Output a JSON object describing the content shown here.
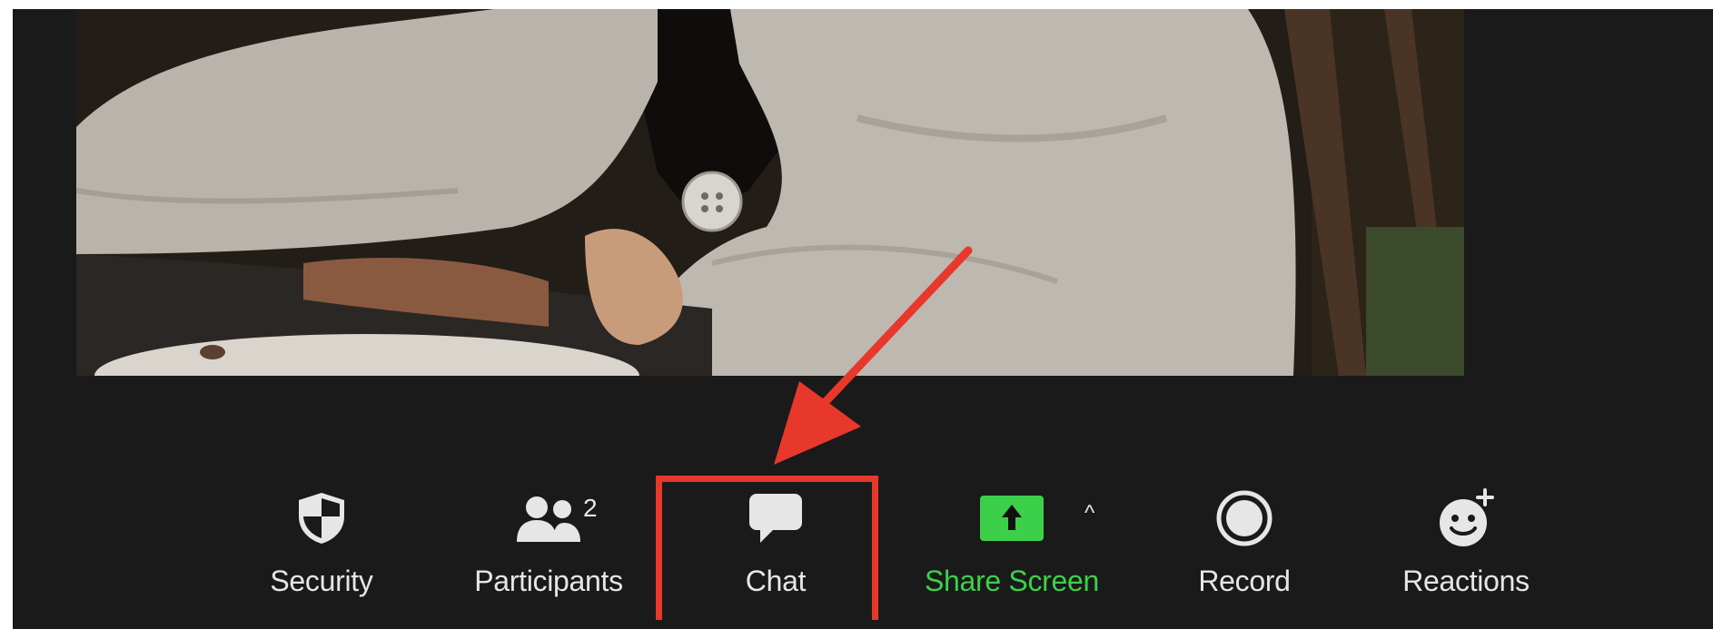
{
  "toolbar": {
    "security_label": "Security",
    "participants_label": "Participants",
    "participants_count": "2",
    "chat_label": "Chat",
    "share_label": "Share Screen",
    "share_options_caret": "^",
    "record_label": "Record",
    "reactions_label": "Reactions"
  },
  "icons": {
    "security": "shield-icon",
    "participants": "people-icon",
    "chat": "chat-bubble-icon",
    "share": "share-screen-icon",
    "record": "record-icon",
    "reactions": "smiley-plus-icon"
  },
  "colors": {
    "toolbar_bg": "#1a1a1a",
    "share_green": "#3cd04a",
    "annotation_red": "#e8382b",
    "text": "#e6e6e6"
  }
}
